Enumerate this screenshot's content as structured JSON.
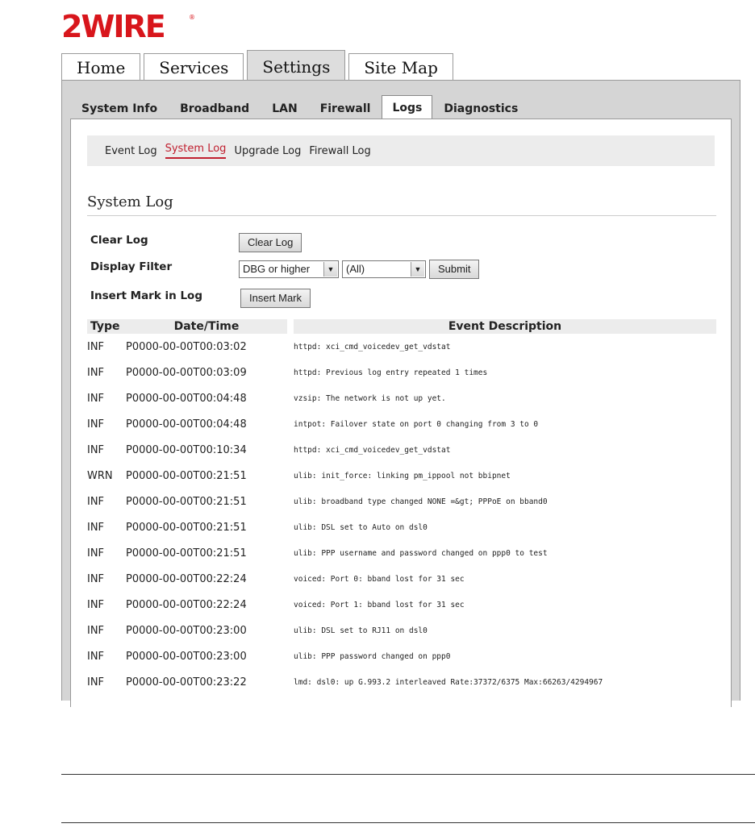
{
  "brand": {
    "logo_text": "2WIRE",
    "accent": "#d8161c"
  },
  "main_tabs": [
    {
      "label": "Home",
      "active": false
    },
    {
      "label": "Services",
      "active": false
    },
    {
      "label": "Settings",
      "active": true
    },
    {
      "label": "Site Map",
      "active": false
    }
  ],
  "sub_tabs": [
    {
      "label": "System Info",
      "active": false
    },
    {
      "label": "Broadband",
      "active": false
    },
    {
      "label": "LAN",
      "active": false
    },
    {
      "label": "Firewall",
      "active": false
    },
    {
      "label": "Logs",
      "active": true
    },
    {
      "label": "Diagnostics",
      "active": false
    }
  ],
  "log_nav": [
    {
      "label": "Event Log",
      "active": false
    },
    {
      "label": "System Log",
      "active": true
    },
    {
      "label": "Upgrade Log",
      "active": false
    },
    {
      "label": "Firewall Log",
      "active": false
    }
  ],
  "section_title": "System Log",
  "form": {
    "clear_label": "Clear Log",
    "clear_button": "Clear Log",
    "filter_label": "Display Filter",
    "level_select": "DBG or higher",
    "source_select": "(All)",
    "submit_button": "Submit",
    "mark_label": "Insert Mark in Log",
    "mark_button": "Insert Mark"
  },
  "table": {
    "headers": {
      "type": "Type",
      "datetime": "Date/Time",
      "description": "Event Description"
    },
    "rows": [
      {
        "type": "INF",
        "datetime": "P0000-00-00T00:03:02",
        "desc": "httpd: xci_cmd_voicedev_get_vdstat"
      },
      {
        "type": "INF",
        "datetime": "P0000-00-00T00:03:09",
        "desc": "httpd: Previous log entry repeated 1 times"
      },
      {
        "type": "INF",
        "datetime": "P0000-00-00T00:04:48",
        "desc": "vzsip: The network is not up yet."
      },
      {
        "type": "INF",
        "datetime": "P0000-00-00T00:04:48",
        "desc": "intpot: Failover state on port 0 changing from 3 to 0"
      },
      {
        "type": "INF",
        "datetime": "P0000-00-00T00:10:34",
        "desc": "httpd: xci_cmd_voicedev_get_vdstat"
      },
      {
        "type": "WRN",
        "datetime": "P0000-00-00T00:21:51",
        "desc": "ulib: init_force: linking pm_ippool not bbipnet"
      },
      {
        "type": "INF",
        "datetime": "P0000-00-00T00:21:51",
        "desc": "ulib: broadband type changed NONE =&gt; PPPoE on bband0"
      },
      {
        "type": "INF",
        "datetime": "P0000-00-00T00:21:51",
        "desc": "ulib: DSL set to Auto on dsl0"
      },
      {
        "type": "INF",
        "datetime": "P0000-00-00T00:21:51",
        "desc": "ulib: PPP username and password changed on ppp0 to test"
      },
      {
        "type": "INF",
        "datetime": "P0000-00-00T00:22:24",
        "desc": "voiced: Port 0: bband lost for 31 sec"
      },
      {
        "type": "INF",
        "datetime": "P0000-00-00T00:22:24",
        "desc": "voiced: Port 1: bband lost for 31 sec"
      },
      {
        "type": "INF",
        "datetime": "P0000-00-00T00:23:00",
        "desc": "ulib: DSL set to RJ11 on dsl0"
      },
      {
        "type": "INF",
        "datetime": "P0000-00-00T00:23:00",
        "desc": "ulib: PPP password changed on ppp0"
      },
      {
        "type": "INF",
        "datetime": "P0000-00-00T00:23:22",
        "desc": "lmd: dsl0: up G.993.2 interleaved Rate:37372/6375 Max:66263/4294967"
      }
    ]
  }
}
